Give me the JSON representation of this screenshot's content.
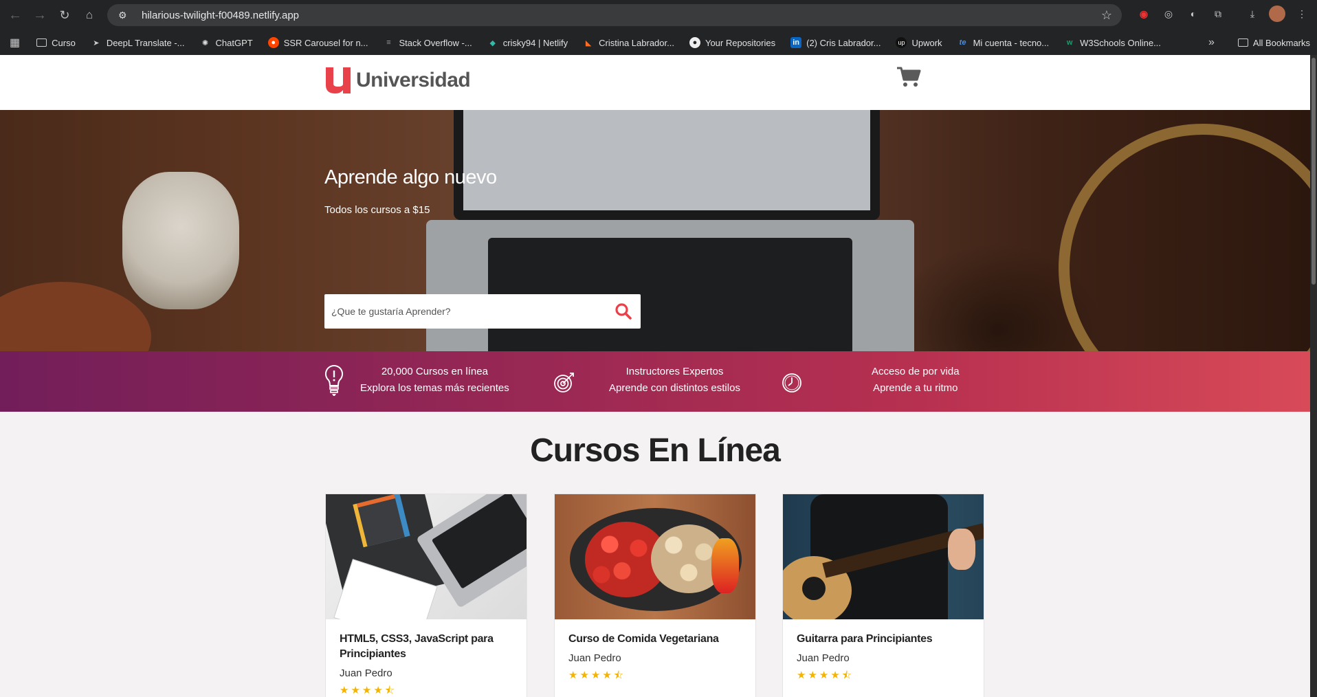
{
  "browser": {
    "url": "hilarious-twilight-f00489.netlify.app",
    "bookmarks": [
      {
        "label": "Curso",
        "icon": "folder-icon"
      },
      {
        "label": "DeepL Translate -...",
        "icon": "deepl-icon"
      },
      {
        "label": "ChatGPT",
        "icon": "chatgpt-icon"
      },
      {
        "label": "SSR Carousel for n...",
        "icon": "reddit-icon"
      },
      {
        "label": "Stack Overflow -...",
        "icon": "stackoverflow-icon"
      },
      {
        "label": "crisky94 | Netlify",
        "icon": "netlify-icon"
      },
      {
        "label": "Cristina Labrador...",
        "icon": "gitlab-icon"
      },
      {
        "label": "Your Repositories",
        "icon": "github-icon"
      },
      {
        "label": "(2) Cris Labrador...",
        "icon": "linkedin-icon"
      },
      {
        "label": "Upwork",
        "icon": "upwork-icon"
      },
      {
        "label": "Mi cuenta - tecno...",
        "icon": "tecno-icon"
      },
      {
        "label": "W3Schools Online...",
        "icon": "w3schools-icon"
      }
    ],
    "all_bookmarks": "All Bookmarks"
  },
  "site": {
    "logo_text": "Universidad",
    "brand_color": "#e8414a",
    "hero": {
      "title": "Aprende algo nuevo",
      "subtitle": "Todos los cursos a $15",
      "search_placeholder": "¿Que te gustaría Aprender?"
    },
    "features": [
      {
        "icon": "lightbulb-icon",
        "line1": "20,000 Cursos en línea",
        "line2": "Explora los temas más recientes"
      },
      {
        "icon": "target-icon",
        "line1": "Instructores Expertos",
        "line2": "Aprende con distintos estilos"
      },
      {
        "icon": "clock-icon",
        "line1": "Acceso de por vida",
        "line2": "Aprende a tu ritmo"
      }
    ],
    "section_title": "Cursos En Línea",
    "courses": [
      {
        "title": "HTML5, CSS3, JavaScript para Principiantes",
        "author": "Juan Pedro",
        "rating": 4.5,
        "stars": "★★★★⯪"
      },
      {
        "title": "Curso de Comida Vegetariana",
        "author": "Juan Pedro",
        "rating": 4.5,
        "stars": "★★★★⯪"
      },
      {
        "title": "Guitarra para Principiantes",
        "author": "Juan Pedro",
        "rating": 4.5,
        "stars": "★★★★⯪"
      }
    ]
  }
}
